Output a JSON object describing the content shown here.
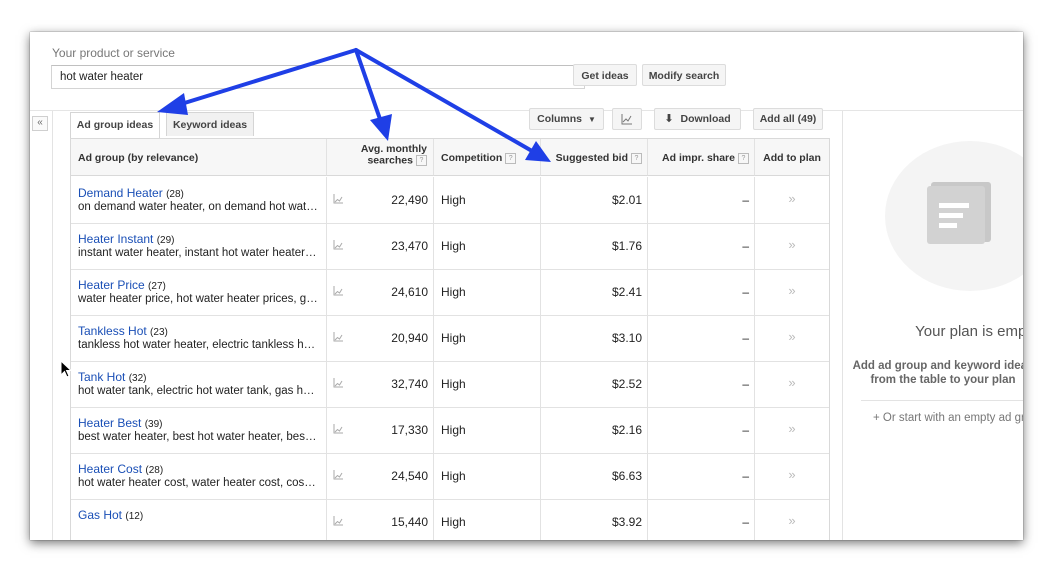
{
  "search": {
    "label": "Your product or service",
    "value": "hot water heater",
    "get_ideas": "Get ideas",
    "modify_search": "Modify search"
  },
  "collapse_icon": "«",
  "tabs": [
    {
      "label": "Ad group ideas",
      "active": true
    },
    {
      "label": "Keyword ideas",
      "active": false
    }
  ],
  "toolbar": {
    "columns": "Columns",
    "download": "Download",
    "add_all": "Add all (49)"
  },
  "headers": {
    "ad_group": "Ad group (by relevance)",
    "avg_monthly_1": "Avg. monthly",
    "avg_monthly_2": "searches",
    "competition": "Competition",
    "suggested_bid": "Suggested bid",
    "ad_impr_share": "Ad impr. share",
    "add_to_plan": "Add to plan",
    "help": "?"
  },
  "rows": [
    {
      "name": "Demand Heater",
      "count": "(28)",
      "keywords": "on demand water heater, on demand hot wat…",
      "searches": "22,490",
      "competition": "High",
      "bid": "$2.01",
      "share": "–"
    },
    {
      "name": "Heater Instant",
      "count": "(29)",
      "keywords": "instant water heater, instant hot water heater…",
      "searches": "23,470",
      "competition": "High",
      "bid": "$1.76",
      "share": "–"
    },
    {
      "name": "Heater Price",
      "count": "(27)",
      "keywords": "water heater price, hot water heater prices, g…",
      "searches": "24,610",
      "competition": "High",
      "bid": "$2.41",
      "share": "–"
    },
    {
      "name": "Tankless Hot",
      "count": "(23)",
      "keywords": "tankless hot water heater, electric tankless h…",
      "searches": "20,940",
      "competition": "High",
      "bid": "$3.10",
      "share": "–"
    },
    {
      "name": "Tank Hot",
      "count": "(32)",
      "keywords": "hot water tank, electric hot water tank, gas h…",
      "searches": "32,740",
      "competition": "High",
      "bid": "$2.52",
      "share": "–"
    },
    {
      "name": "Heater Best",
      "count": "(39)",
      "keywords": "best water heater, best hot water heater, bes…",
      "searches": "17,330",
      "competition": "High",
      "bid": "$2.16",
      "share": "–"
    },
    {
      "name": "Heater Cost",
      "count": "(28)",
      "keywords": "hot water heater cost, water heater cost, cos…",
      "searches": "24,540",
      "competition": "High",
      "bid": "$6.63",
      "share": "–"
    },
    {
      "name": "Gas Hot",
      "count": "(12)",
      "keywords": "",
      "searches": "15,440",
      "competition": "High",
      "bid": "$3.92",
      "share": "–"
    }
  ],
  "icons": {
    "trend": "trend-chart-icon",
    "add": "»"
  },
  "plan": {
    "empty": "Your plan is empty",
    "desc_1": "Add ad group and keyword ideas",
    "desc_2": "from the table to your plan",
    "alt": "+ Or start with an empty ad group"
  },
  "colors": {
    "link": "#1a4fb6",
    "arrow": "#1f3fe6"
  }
}
